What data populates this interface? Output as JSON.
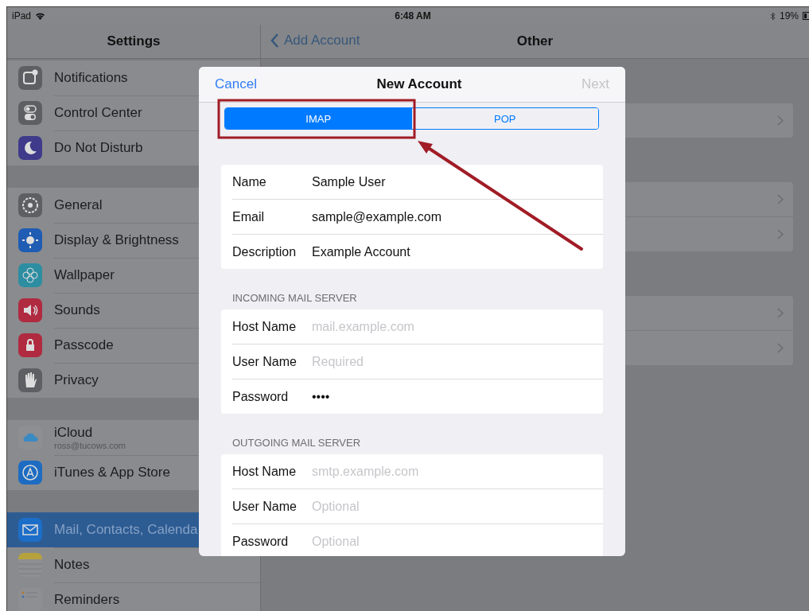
{
  "status_bar": {
    "device": "iPad",
    "time": "6:48 AM",
    "battery": "19%"
  },
  "sidebar": {
    "title": "Settings",
    "groups": [
      {
        "items": [
          {
            "label": "Notifications",
            "color": "#5e5f63",
            "selected": false
          },
          {
            "label": "Control Center",
            "color": "#5e5f63",
            "selected": false
          },
          {
            "label": "Do Not Disturb",
            "color": "#3f3a8a",
            "selected": false
          }
        ]
      },
      {
        "items": [
          {
            "label": "General",
            "color": "#5e5f63",
            "selected": false
          },
          {
            "label": "Display & Brightness",
            "color": "#1f5cb3",
            "selected": false
          },
          {
            "label": "Wallpaper",
            "color": "#2d8ea2",
            "selected": false
          },
          {
            "label": "Sounds",
            "color": "#b02a40",
            "selected": false
          },
          {
            "label": "Passcode",
            "color": "#b02a40",
            "selected": false
          },
          {
            "label": "Privacy",
            "color": "#5e5f63",
            "selected": false
          }
        ]
      },
      {
        "items": [
          {
            "label": "iCloud",
            "subtitle": "ross@tucows.com",
            "color": "#8e8f92",
            "selected": false
          },
          {
            "label": "iTunes & App Store",
            "color": "#1d6cc2",
            "selected": false
          }
        ]
      },
      {
        "items": [
          {
            "label": "Mail, Contacts, Calenda",
            "color": "#1d6ec8",
            "selected": true
          },
          {
            "label": "Notes",
            "color": "#8e8f92",
            "selected": false
          },
          {
            "label": "Reminders",
            "color": "#8e8f92",
            "selected": false
          }
        ]
      }
    ]
  },
  "detail": {
    "back": "Add Account",
    "title": "Other",
    "groups": [
      {
        "rows": [
          {
            "chevron": true
          }
        ]
      },
      {
        "rows": [
          {
            "chevron": true
          },
          {
            "chevron": true
          }
        ]
      },
      {
        "rows": [
          {
            "chevron": true
          },
          {
            "chevron": true
          }
        ]
      }
    ]
  },
  "modal": {
    "cancel": "Cancel",
    "title": "New Account",
    "next": {
      "label": "Next",
      "disabled": true
    },
    "segments": [
      {
        "label": "IMAP",
        "selected": true
      },
      {
        "label": "POP",
        "selected": false
      }
    ],
    "sections": [
      {
        "fields": [
          {
            "label": "Name",
            "value": "Sample User"
          },
          {
            "label": "Email",
            "value": "sample@example.com"
          },
          {
            "label": "Description",
            "value": "Example Account"
          }
        ]
      },
      {
        "header": "INCOMING MAIL SERVER",
        "fields": [
          {
            "label": "Host Name",
            "placeholder": "mail.example.com"
          },
          {
            "label": "User Name",
            "placeholder": "Required"
          },
          {
            "label": "Password",
            "value": "••••"
          }
        ]
      },
      {
        "header": "OUTGOING MAIL SERVER",
        "fields": [
          {
            "label": "Host Name",
            "placeholder": "smtp.example.com"
          },
          {
            "label": "User Name",
            "placeholder": "Optional"
          },
          {
            "label": "Password",
            "placeholder": "Optional"
          }
        ]
      }
    ]
  }
}
